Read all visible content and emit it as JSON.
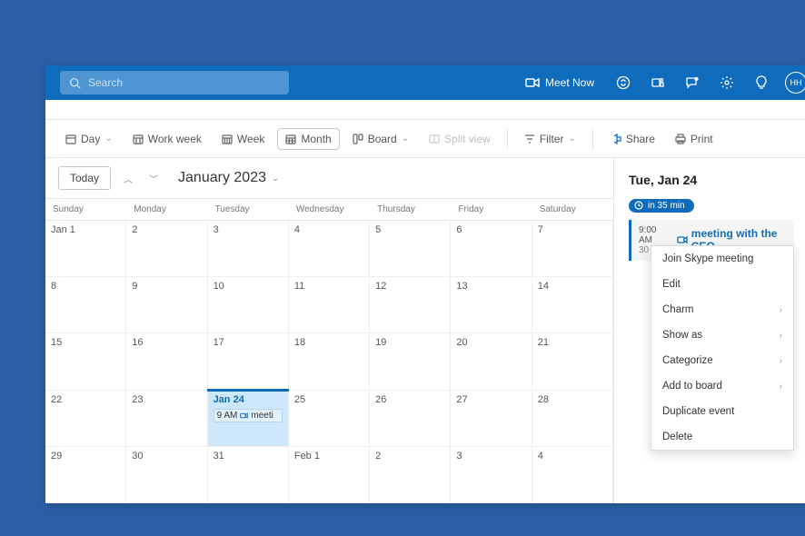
{
  "topbar": {
    "search_placeholder": "Search",
    "meet_now": "Meet Now",
    "avatar_initials": "HH"
  },
  "toolbar": {
    "day": "Day",
    "work_week": "Work week",
    "week": "Week",
    "month": "Month",
    "board": "Board",
    "split_view": "Split view",
    "filter": "Filter",
    "share": "Share",
    "print": "Print"
  },
  "calendar": {
    "today": "Today",
    "month_label": "January 2023",
    "weekdays": [
      "Sunday",
      "Monday",
      "Tuesday",
      "Wednesday",
      "Thursday",
      "Friday",
      "Saturday"
    ],
    "cells": [
      "Jan 1",
      "2",
      "3",
      "4",
      "5",
      "6",
      "7",
      "8",
      "9",
      "10",
      "11",
      "12",
      "13",
      "14",
      "15",
      "16",
      "17",
      "18",
      "19",
      "20",
      "21",
      "22",
      "23",
      "Jan 24",
      "25",
      "26",
      "27",
      "28",
      "29",
      "30",
      "31",
      "Feb 1",
      "2",
      "3",
      "4"
    ],
    "selected_index": 23,
    "event_on_selected": {
      "time": "9 AM",
      "title": "meeti"
    }
  },
  "panel": {
    "date": "Tue, Jan 24",
    "countdown": "in 35 min",
    "event": {
      "time": "9:00 AM",
      "duration": "30 m",
      "title": "meeting with the CEO"
    }
  },
  "context_menu": {
    "items": [
      {
        "label": "Join Skype meeting",
        "submenu": false
      },
      {
        "label": "Edit",
        "submenu": false
      },
      {
        "label": "Charm",
        "submenu": true
      },
      {
        "label": "Show as",
        "submenu": true
      },
      {
        "label": "Categorize",
        "submenu": true
      },
      {
        "label": "Add to board",
        "submenu": true
      },
      {
        "label": "Duplicate event",
        "submenu": false
      },
      {
        "label": "Delete",
        "submenu": false
      }
    ]
  }
}
